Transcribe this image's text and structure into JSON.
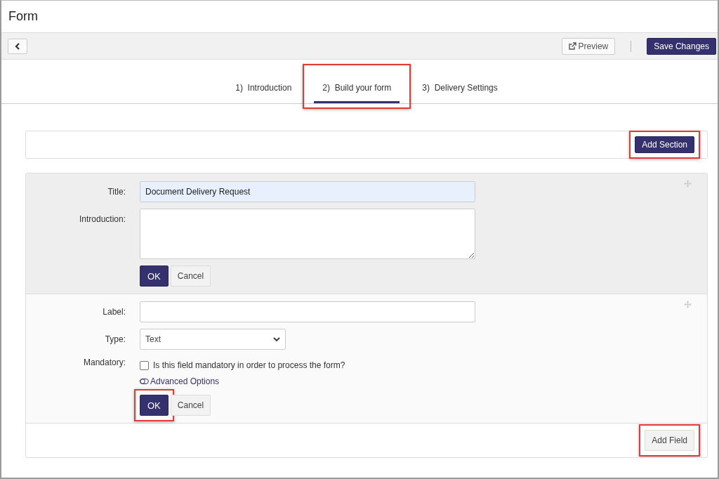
{
  "page_title": "Form",
  "toolbar": {
    "preview": "Preview",
    "save": "Save Changes"
  },
  "tabs": [
    {
      "label": "1)  Introduction",
      "selected": false,
      "highlighted": false
    },
    {
      "label": "2)  Build your form",
      "selected": true,
      "highlighted": true
    },
    {
      "label": "3)  Delivery Settings",
      "selected": false,
      "highlighted": false
    }
  ],
  "add_section": {
    "label": "Add Section",
    "highlighted": true
  },
  "section_editor": {
    "title_label": "Title:",
    "title_value": "Document Delivery Request",
    "intro_label": "Introduction:",
    "ok": {
      "label": "OK"
    },
    "cancel": "Cancel"
  },
  "field_editor": {
    "label_label": "Label:",
    "type_label": "Type:",
    "type_value": "Text",
    "mandatory_label": "Mandatory:",
    "mandatory": {
      "text": "Is this field mandatory in order to process the form?",
      "checked": false
    },
    "advanced": "Advanced Options",
    "ok": {
      "label": "OK",
      "highlighted": true
    },
    "cancel": "Cancel"
  },
  "add_field": {
    "label": "Add Field",
    "highlighted": true
  }
}
